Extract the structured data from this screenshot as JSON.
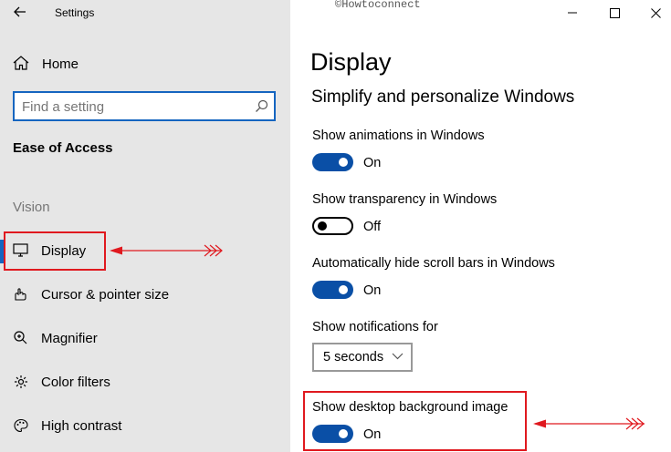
{
  "window": {
    "title": "Settings",
    "watermark": "©Howtoconnect"
  },
  "sidebar": {
    "home_label": "Home",
    "search_placeholder": "Find a setting",
    "section_title": "Ease of Access",
    "group_label": "Vision",
    "items": [
      {
        "label": "Display",
        "icon": "monitor-icon",
        "selected": true
      },
      {
        "label": "Cursor & pointer size",
        "icon": "cursor-icon",
        "selected": false
      },
      {
        "label": "Magnifier",
        "icon": "magnifier-icon",
        "selected": false
      },
      {
        "label": "Color filters",
        "icon": "color-filters-icon",
        "selected": false
      },
      {
        "label": "High contrast",
        "icon": "high-contrast-icon",
        "selected": false
      }
    ]
  },
  "main": {
    "title": "Display",
    "subtitle": "Simplify and personalize Windows",
    "settings": [
      {
        "label": "Show animations in Windows",
        "state": "On"
      },
      {
        "label": "Show transparency in Windows",
        "state": "Off"
      },
      {
        "label": "Automatically hide scroll bars in Windows",
        "state": "On"
      }
    ],
    "notifications": {
      "label": "Show notifications for",
      "value": "5 seconds"
    },
    "background": {
      "label": "Show desktop background image",
      "state": "On"
    }
  },
  "colors": {
    "accent": "#0a4fa6",
    "annotation": "#e0191f",
    "sidebar_bg": "#e6e6e6"
  }
}
